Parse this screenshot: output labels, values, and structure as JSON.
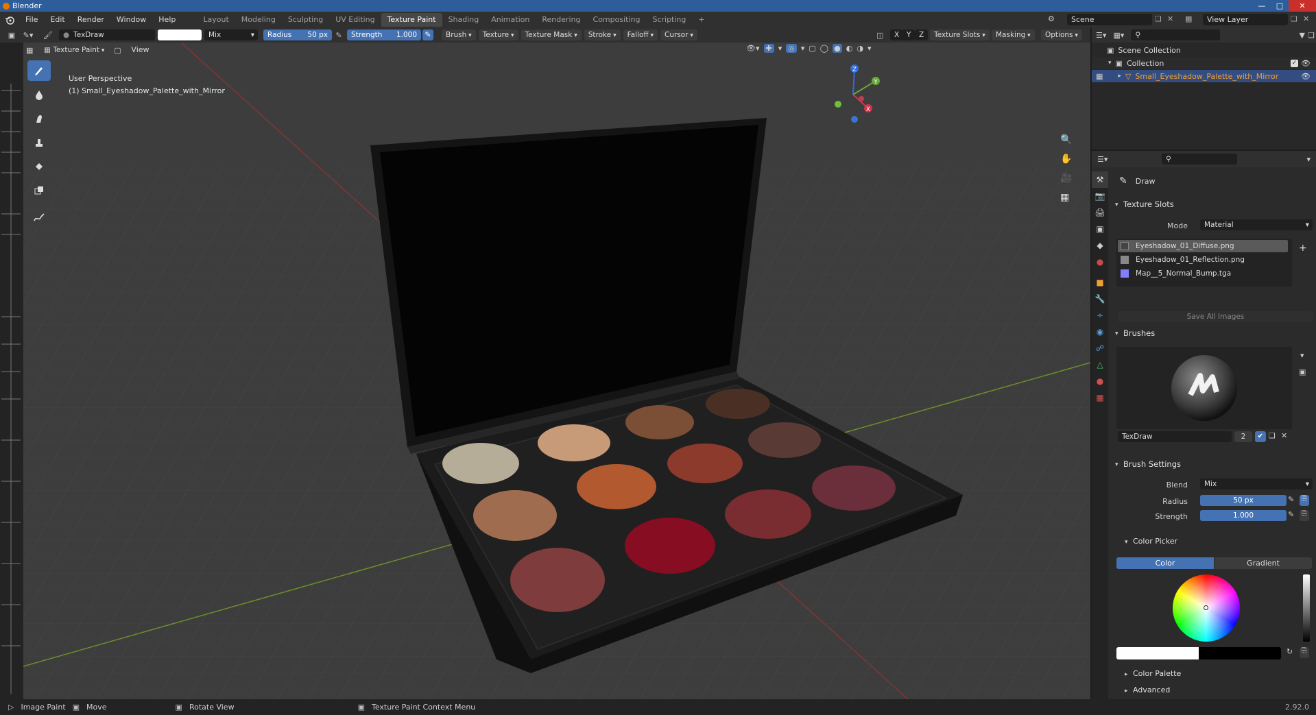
{
  "window": {
    "title": "Blender"
  },
  "menu": [
    "File",
    "Edit",
    "Render",
    "Window",
    "Help"
  ],
  "workspaces": [
    "Layout",
    "Modeling",
    "Sculpting",
    "UV Editing",
    "Texture Paint",
    "Shading",
    "Animation",
    "Rendering",
    "Compositing",
    "Scripting"
  ],
  "active_workspace": "Texture Paint",
  "scene": {
    "name": "Scene",
    "view_layer": "View Layer"
  },
  "tool_header": {
    "brush_name": "TexDraw",
    "blend": "Mix",
    "radius_label": "Radius",
    "radius_value": "50 px",
    "strength_label": "Strength",
    "strength_value": "1.000",
    "menus": [
      "Brush",
      "Texture",
      "Texture Mask",
      "Stroke",
      "Falloff",
      "Cursor"
    ],
    "axes": [
      "X",
      "Y",
      "Z"
    ],
    "right_menus": [
      "Texture Slots",
      "Masking",
      "Options"
    ]
  },
  "viewport_header": {
    "mode": "Texture Paint",
    "view": "View"
  },
  "viewport": {
    "info_line1": "User Perspective",
    "info_line2": "(1) Small_Eyeshadow_Palette_with_Mirror",
    "gizmo": {
      "x": "X",
      "y": "Y",
      "z": "Z"
    }
  },
  "outliner": {
    "scene_collection": "Scene Collection",
    "collection": "Collection",
    "object": "Small_Eyeshadow_Palette_with_Mirror"
  },
  "properties": {
    "tool_name": "Draw",
    "texture_slots": {
      "title": "Texture Slots",
      "mode_label": "Mode",
      "mode_value": "Material",
      "slots": [
        "Eyeshadow_01_Diffuse.png",
        "Eyeshadow_01_Reflection.png",
        "Map__5_Normal_Bump.tga"
      ],
      "save_all": "Save All Images"
    },
    "brushes": {
      "title": "Brushes",
      "brush_name": "TexDraw",
      "users": "2"
    },
    "brush_settings": {
      "title": "Brush Settings",
      "blend_label": "Blend",
      "blend_value": "Mix",
      "radius_label": "Radius",
      "radius_value": "50 px",
      "strength_label": "Strength",
      "strength_value": "1.000"
    },
    "color_picker": {
      "title": "Color Picker",
      "tab_color": "Color",
      "tab_gradient": "Gradient"
    },
    "color_palette": "Color Palette",
    "advanced": "Advanced"
  },
  "statusbar": {
    "item1": "Image Paint",
    "item2": "Move",
    "item3": "Rotate View",
    "item4": "Texture Paint Context Menu",
    "version": "2.92.0"
  },
  "colors": {
    "accent": "#4472b3",
    "title_bar": "#2d5d9a",
    "highlight_text": "#f0a030"
  },
  "palette_colors": [
    "#b5ad98",
    "#c79a78",
    "#7b4e36",
    "#4a2f25",
    "#9f6c4f",
    "#b3592f",
    "#8b3a2c",
    "#5a3a35",
    "#7e3c3c",
    "#860d22",
    "#7a2d30",
    "#6a2f3a"
  ]
}
